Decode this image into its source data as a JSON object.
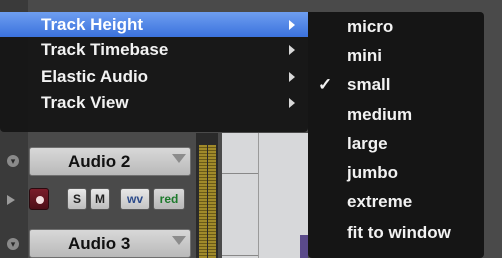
{
  "context_menu": {
    "items": [
      {
        "label": "Track Height",
        "highlighted": true,
        "has_submenu": true
      },
      {
        "label": "Track Timebase",
        "highlighted": false,
        "has_submenu": true
      },
      {
        "label": "Elastic Audio",
        "highlighted": false,
        "has_submenu": true
      },
      {
        "label": "Track View",
        "highlighted": false,
        "has_submenu": true
      }
    ],
    "highlight_color": "#3b72dd"
  },
  "track_height_submenu": {
    "items": [
      {
        "label": "micro",
        "checked": false
      },
      {
        "label": "mini",
        "checked": false
      },
      {
        "label": "small",
        "checked": true
      },
      {
        "label": "medium",
        "checked": false
      },
      {
        "label": "large",
        "checked": false
      },
      {
        "label": "jumbo",
        "checked": false
      },
      {
        "label": "extreme",
        "checked": false
      },
      {
        "label": "fit to window",
        "checked": false
      }
    ],
    "check_glyph": "✓"
  },
  "tracks": [
    {
      "name": "Audio 2",
      "buttons": {
        "solo": "S",
        "mute": "M",
        "view": "wv",
        "color": "red"
      },
      "record_enabled": false
    },
    {
      "name": "Audio 3"
    }
  ],
  "colors": {
    "record_button": "#6a1622",
    "view_label": "#2b4a8a",
    "color_label": "#1d7a2c",
    "meter": "#a08a2a"
  }
}
